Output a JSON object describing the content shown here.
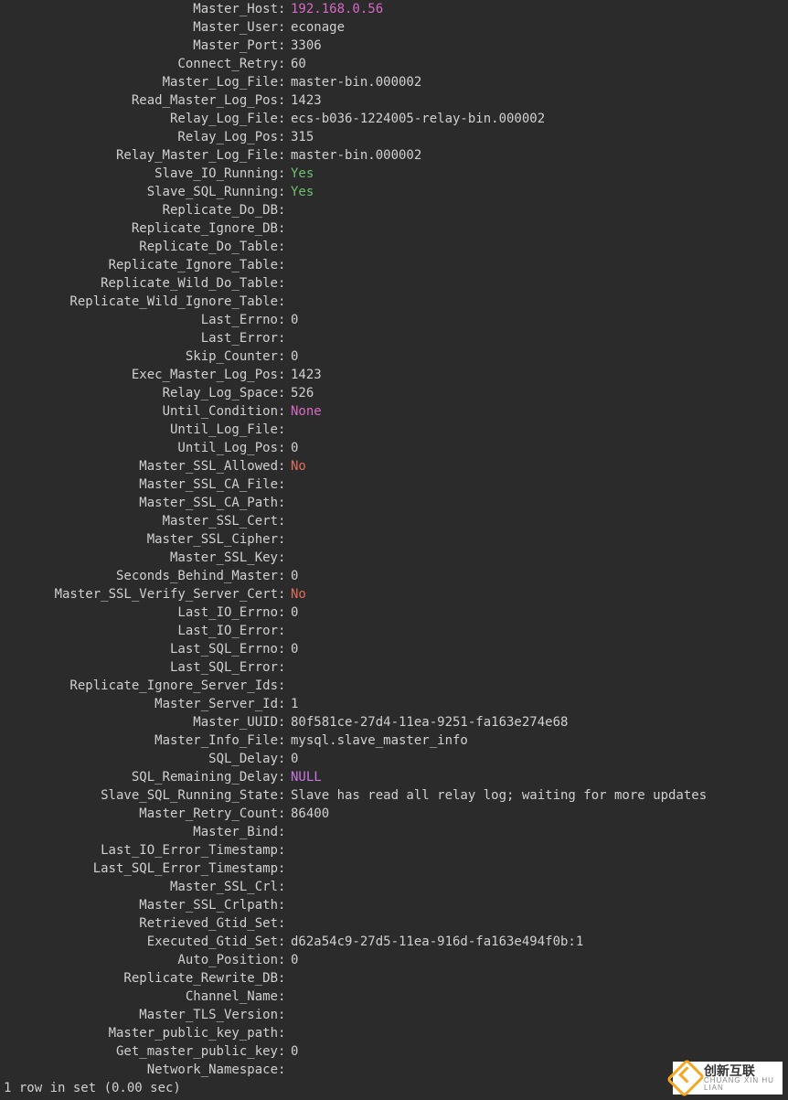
{
  "rows": [
    {
      "label": "Master_Host",
      "value": "192.168.0.56",
      "cls": "v-magenta"
    },
    {
      "label": "Master_User",
      "value": "econage"
    },
    {
      "label": "Master_Port",
      "value": "3306"
    },
    {
      "label": "Connect_Retry",
      "value": "60"
    },
    {
      "label": "Master_Log_File",
      "value": "master-bin.000002"
    },
    {
      "label": "Read_Master_Log_Pos",
      "value": "1423"
    },
    {
      "label": "Relay_Log_File",
      "value": "ecs-b036-1224005-relay-bin.000002"
    },
    {
      "label": "Relay_Log_Pos",
      "value": "315"
    },
    {
      "label": "Relay_Master_Log_File",
      "value": "master-bin.000002"
    },
    {
      "label": "Slave_IO_Running",
      "value": "Yes",
      "cls": "v-green"
    },
    {
      "label": "Slave_SQL_Running",
      "value": "Yes",
      "cls": "v-green"
    },
    {
      "label": "Replicate_Do_DB",
      "value": ""
    },
    {
      "label": "Replicate_Ignore_DB",
      "value": ""
    },
    {
      "label": "Replicate_Do_Table",
      "value": ""
    },
    {
      "label": "Replicate_Ignore_Table",
      "value": ""
    },
    {
      "label": "Replicate_Wild_Do_Table",
      "value": ""
    },
    {
      "label": "Replicate_Wild_Ignore_Table",
      "value": ""
    },
    {
      "label": "Last_Errno",
      "value": "0"
    },
    {
      "label": "Last_Error",
      "value": ""
    },
    {
      "label": "Skip_Counter",
      "value": "0"
    },
    {
      "label": "Exec_Master_Log_Pos",
      "value": "1423"
    },
    {
      "label": "Relay_Log_Space",
      "value": "526"
    },
    {
      "label": "Until_Condition",
      "value": "None",
      "cls": "v-magenta"
    },
    {
      "label": "Until_Log_File",
      "value": ""
    },
    {
      "label": "Until_Log_Pos",
      "value": "0"
    },
    {
      "label": "Master_SSL_Allowed",
      "value": "No",
      "cls": "v-red"
    },
    {
      "label": "Master_SSL_CA_File",
      "value": ""
    },
    {
      "label": "Master_SSL_CA_Path",
      "value": ""
    },
    {
      "label": "Master_SSL_Cert",
      "value": ""
    },
    {
      "label": "Master_SSL_Cipher",
      "value": ""
    },
    {
      "label": "Master_SSL_Key",
      "value": ""
    },
    {
      "label": "Seconds_Behind_Master",
      "value": "0"
    },
    {
      "label": "Master_SSL_Verify_Server_Cert",
      "value": "No",
      "cls": "v-red"
    },
    {
      "label": "Last_IO_Errno",
      "value": "0"
    },
    {
      "label": "Last_IO_Error",
      "value": ""
    },
    {
      "label": "Last_SQL_Errno",
      "value": "0"
    },
    {
      "label": "Last_SQL_Error",
      "value": ""
    },
    {
      "label": "Replicate_Ignore_Server_Ids",
      "value": ""
    },
    {
      "label": "Master_Server_Id",
      "value": "1"
    },
    {
      "label": "Master_UUID",
      "value": "80f581ce-27d4-11ea-9251-fa163e274e68"
    },
    {
      "label": "Master_Info_File",
      "value": "mysql.slave_master_info"
    },
    {
      "label": "SQL_Delay",
      "value": "0"
    },
    {
      "label": "SQL_Remaining_Delay",
      "value": "NULL",
      "cls": "v-purple"
    },
    {
      "label": "Slave_SQL_Running_State",
      "value": "Slave has read all relay log; waiting for more updates"
    },
    {
      "label": "Master_Retry_Count",
      "value": "86400"
    },
    {
      "label": "Master_Bind",
      "value": ""
    },
    {
      "label": "Last_IO_Error_Timestamp",
      "value": ""
    },
    {
      "label": "Last_SQL_Error_Timestamp",
      "value": ""
    },
    {
      "label": "Master_SSL_Crl",
      "value": ""
    },
    {
      "label": "Master_SSL_Crlpath",
      "value": ""
    },
    {
      "label": "Retrieved_Gtid_Set",
      "value": ""
    },
    {
      "label": "Executed_Gtid_Set",
      "value": "d62a54c9-27d5-11ea-916d-fa163e494f0b:1"
    },
    {
      "label": "Auto_Position",
      "value": "0"
    },
    {
      "label": "Replicate_Rewrite_DB",
      "value": ""
    },
    {
      "label": "Channel_Name",
      "value": ""
    },
    {
      "label": "Master_TLS_Version",
      "value": ""
    },
    {
      "label": "Master_public_key_path",
      "value": ""
    },
    {
      "label": "Get_master_public_key",
      "value": "0"
    },
    {
      "label": "Network_Namespace",
      "value": ""
    }
  ],
  "footer": "1 row in set (0.00 sec)",
  "logo": {
    "big": "创新互联",
    "small": "CHUANG XIN HU LIAN"
  }
}
